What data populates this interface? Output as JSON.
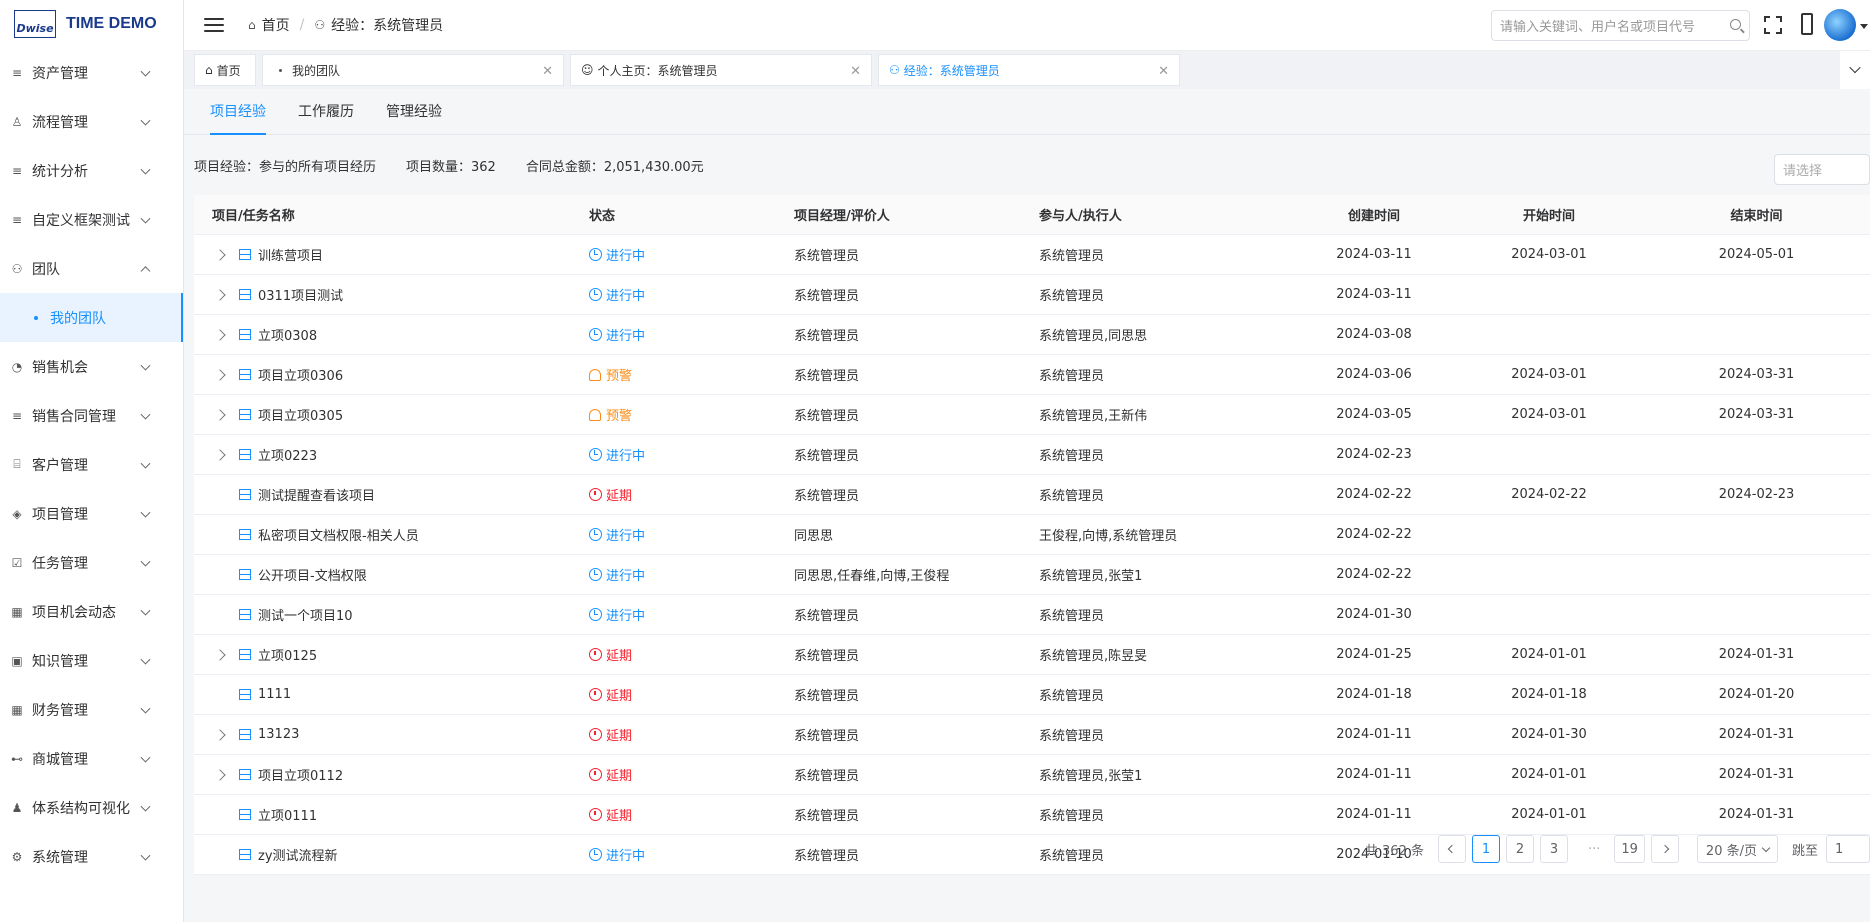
{
  "app": {
    "logo_text": "Dwise",
    "title": "TIME DEMO"
  },
  "sidebar": {
    "items": [
      {
        "label": "资产管理",
        "icon": "list-icon"
      },
      {
        "label": "流程管理",
        "icon": "user-icon"
      },
      {
        "label": "统计分析",
        "icon": "list-icon"
      },
      {
        "label": "自定义框架测试",
        "icon": "list-icon"
      },
      {
        "label": "团队",
        "icon": "team-icon",
        "expanded": true
      },
      {
        "label": "销售机会",
        "icon": "pie-icon"
      },
      {
        "label": "销售合同管理",
        "icon": "list-icon"
      },
      {
        "label": "客户管理",
        "icon": "customer-icon"
      },
      {
        "label": "项目管理",
        "icon": "layers-icon"
      },
      {
        "label": "任务管理",
        "icon": "task-icon"
      },
      {
        "label": "项目机会动态",
        "icon": "calendar-icon"
      },
      {
        "label": "知识管理",
        "icon": "book-icon"
      },
      {
        "label": "财务管理",
        "icon": "grid-icon"
      },
      {
        "label": "商城管理",
        "icon": "cart-icon"
      },
      {
        "label": "体系结构可视化",
        "icon": "org-icon"
      },
      {
        "label": "系统管理",
        "icon": "gear-icon"
      }
    ],
    "sub_item": "我的团队"
  },
  "topbar": {
    "breadcrumb_home": "首页",
    "breadcrumb_current": "经验：系统管理员",
    "search_placeholder": "请输入关键词、用户名或项目代号"
  },
  "tabs": [
    {
      "label": "首页"
    },
    {
      "label": "我的团队"
    },
    {
      "label": "个人主页：系统管理员"
    },
    {
      "label": "经验：系统管理员"
    }
  ],
  "subtabs": [
    "项目经验",
    "工作履历",
    "管理经验"
  ],
  "summary": {
    "desc": "项目经验：参与的所有项目经历",
    "count": "项目数量：362",
    "amount": "合同总金额：2,051,430.00元",
    "select_placeholder": "请选择"
  },
  "table": {
    "headers": [
      "项目/任务名称",
      "状态",
      "项目经理/评价人",
      "参与人/执行人",
      "创建时间",
      "开始时间",
      "结束时间"
    ],
    "rows": [
      {
        "name": "训练营项目",
        "exp": true,
        "status": "进行中",
        "type": "blue",
        "pm": "系统管理员",
        "member": "系统管理员",
        "created": "2024-03-11",
        "start": "2024-03-01",
        "end": "2024-05-01"
      },
      {
        "name": "0311项目测试",
        "exp": true,
        "status": "进行中",
        "type": "blue",
        "pm": "系统管理员",
        "member": "系统管理员",
        "created": "2024-03-11",
        "start": "",
        "end": ""
      },
      {
        "name": "立项0308",
        "exp": true,
        "status": "进行中",
        "type": "blue",
        "pm": "系统管理员",
        "member": "系统管理员,同思思",
        "created": "2024-03-08",
        "start": "",
        "end": ""
      },
      {
        "name": "项目立项0306",
        "exp": true,
        "status": "预警",
        "type": "orange",
        "pm": "系统管理员",
        "member": "系统管理员",
        "created": "2024-03-06",
        "start": "2024-03-01",
        "end": "2024-03-31"
      },
      {
        "name": "项目立项0305",
        "exp": true,
        "status": "预警",
        "type": "orange",
        "pm": "系统管理员",
        "member": "系统管理员,王新伟",
        "created": "2024-03-05",
        "start": "2024-03-01",
        "end": "2024-03-31"
      },
      {
        "name": "立项0223",
        "exp": true,
        "status": "进行中",
        "type": "blue",
        "pm": "系统管理员",
        "member": "系统管理员",
        "created": "2024-02-23",
        "start": "",
        "end": ""
      },
      {
        "name": "测试提醒查看该项目",
        "exp": false,
        "status": "延期",
        "type": "red",
        "pm": "系统管理员",
        "member": "系统管理员",
        "created": "2024-02-22",
        "start": "2024-02-22",
        "end": "2024-02-23"
      },
      {
        "name": "私密项目文档权限-相关人员",
        "exp": false,
        "status": "进行中",
        "type": "blue",
        "pm": "同思思",
        "member": "王俊程,向博,系统管理员",
        "created": "2024-02-22",
        "start": "",
        "end": ""
      },
      {
        "name": "公开项目-文档权限",
        "exp": false,
        "status": "进行中",
        "type": "blue",
        "pm": "同思思,任春维,向博,王俊程",
        "member": "系统管理员,张莹1",
        "created": "2024-02-22",
        "start": "",
        "end": ""
      },
      {
        "name": "测试一个项目10",
        "exp": false,
        "status": "进行中",
        "type": "blue",
        "pm": "系统管理员",
        "member": "系统管理员",
        "created": "2024-01-30",
        "start": "",
        "end": ""
      },
      {
        "name": "立项0125",
        "exp": true,
        "status": "延期",
        "type": "red",
        "pm": "系统管理员",
        "member": "系统管理员,陈昱旻",
        "created": "2024-01-25",
        "start": "2024-01-01",
        "end": "2024-01-31"
      },
      {
        "name": "1111",
        "exp": false,
        "status": "延期",
        "type": "red",
        "pm": "系统管理员",
        "member": "系统管理员",
        "created": "2024-01-18",
        "start": "2024-01-18",
        "end": "2024-01-20"
      },
      {
        "name": "13123",
        "exp": true,
        "status": "延期",
        "type": "red",
        "pm": "系统管理员",
        "member": "系统管理员",
        "created": "2024-01-11",
        "start": "2024-01-30",
        "end": "2024-01-31"
      },
      {
        "name": "项目立项0112",
        "exp": true,
        "status": "延期",
        "type": "red",
        "pm": "系统管理员",
        "member": "系统管理员,张莹1",
        "created": "2024-01-11",
        "start": "2024-01-01",
        "end": "2024-01-31"
      },
      {
        "name": "立项0111",
        "exp": false,
        "status": "延期",
        "type": "red",
        "pm": "系统管理员",
        "member": "系统管理员",
        "created": "2024-01-11",
        "start": "2024-01-01",
        "end": "2024-01-31"
      },
      {
        "name": "zy测试流程新",
        "exp": false,
        "status": "进行中",
        "type": "blue",
        "pm": "系统管理员",
        "member": "系统管理员",
        "created": "2024-01-10",
        "start": "",
        "end": ""
      }
    ]
  },
  "pager": {
    "total": "共 362 条",
    "pages": [
      "1",
      "2",
      "3"
    ],
    "dots": "···",
    "last": "19",
    "size": "20 条/页",
    "jump_label": "跳至",
    "jump_value": "1"
  },
  "colors": {
    "accent": "#1890ff",
    "warn": "#fa8c16",
    "danger": "#f5222d"
  }
}
